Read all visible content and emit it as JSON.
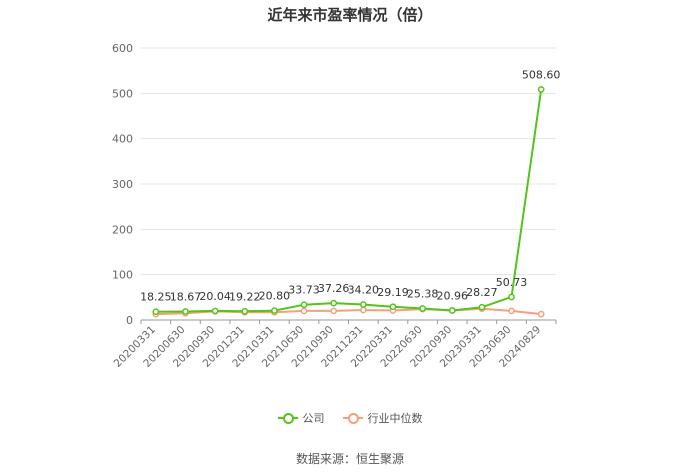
{
  "chart_data": {
    "type": "line",
    "title": "近年来市盈率情况（倍）",
    "categories": [
      "20200331",
      "20200630",
      "20200930",
      "20201231",
      "20210331",
      "20210630",
      "20210930",
      "20211231",
      "20220331",
      "20220630",
      "20220930",
      "20230331",
      "20230630",
      "20240829"
    ],
    "series": [
      {
        "name": "公司",
        "color": "#52c41a",
        "values": [
          18.25,
          18.67,
          20.04,
          19.22,
          20.8,
          33.73,
          37.26,
          34.2,
          29.19,
          25.38,
          20.96,
          28.27,
          50.73,
          508.6
        ],
        "labels": [
          "18.25",
          "18.67",
          "20.04",
          "19.22",
          "20.80",
          "33.73",
          "37.26",
          "34.20",
          "29.19",
          "25.38",
          "20.96",
          "28.27",
          "50.73",
          "508.60"
        ]
      },
      {
        "name": "行业中位数",
        "color": "#f4a07a",
        "values": [
          13,
          15,
          19,
          17,
          17,
          20,
          20,
          22,
          21,
          24,
          21,
          25,
          20,
          13
        ]
      }
    ],
    "ylim": [
      0,
      600
    ],
    "yticks": [
      0,
      100,
      200,
      300,
      400,
      500,
      600
    ],
    "legend_position": "bottom",
    "grid": "horizontal"
  },
  "source": "数据来源：恒生聚源"
}
